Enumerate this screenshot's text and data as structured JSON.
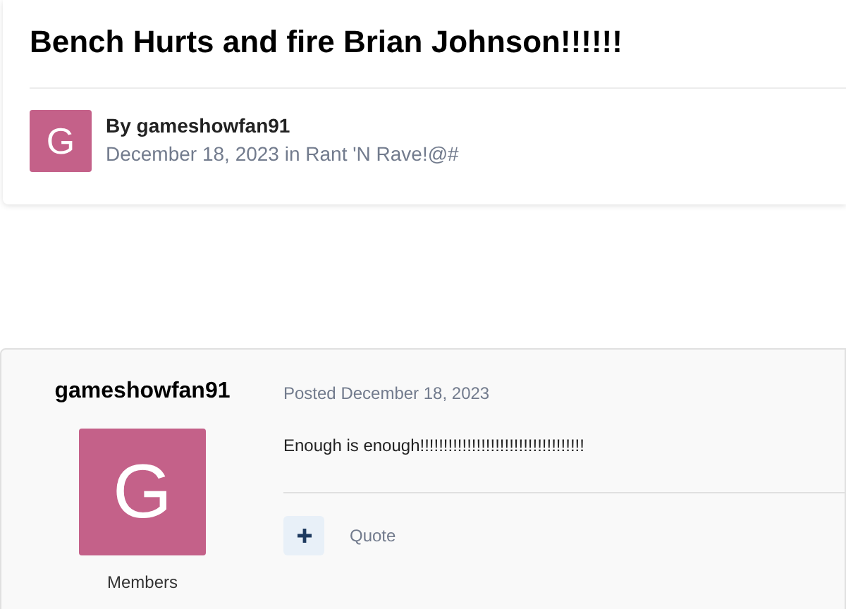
{
  "topic": {
    "title": "Bench Hurts and fire Brian Johnson!!!!!!",
    "author": {
      "avatar_letter": "G",
      "byline": "By gameshowfan91",
      "meta": "December 18, 2023 in Rant 'N Rave!@#"
    }
  },
  "post": {
    "author_name": "gameshowfan91",
    "avatar_letter": "G",
    "group": "Members",
    "posted": "Posted December 18, 2023",
    "body": "Enough is enough!!!!!!!!!!!!!!!!!!!!!!!!!!!!!!!!!!!",
    "actions": {
      "quote": "Quote"
    }
  }
}
